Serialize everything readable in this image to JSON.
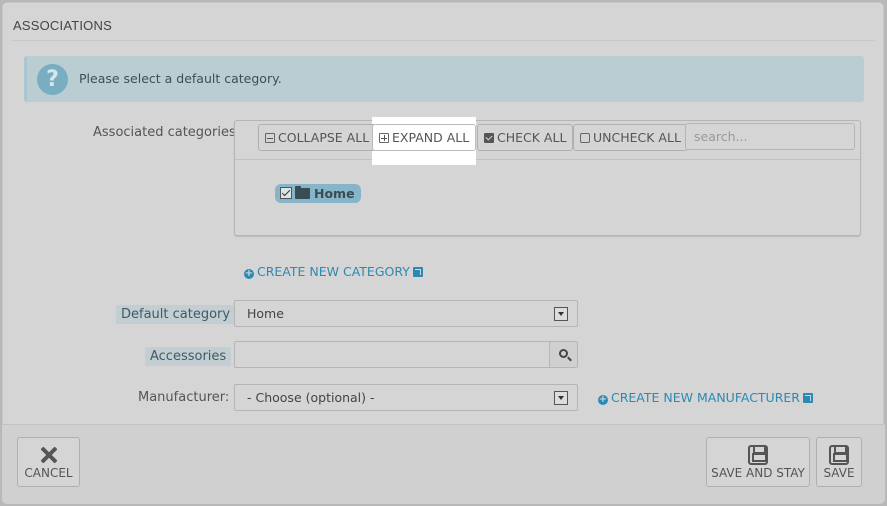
{
  "panel": {
    "heading": "ASSOCIATIONS"
  },
  "alert": {
    "icon": "question-icon",
    "icon_glyph": "?",
    "text": "Please select a default category."
  },
  "categories": {
    "label": "Associated categories",
    "toolbar": {
      "collapse_all": "COLLAPSE ALL",
      "expand_all": "EXPAND ALL",
      "check_all": "CHECK ALL",
      "uncheck_all": "UNCHECK ALL",
      "search_placeholder": "search..."
    },
    "tree": [
      {
        "label": "Home",
        "checked": true,
        "icon": "folder-open-icon"
      }
    ],
    "create_link": "CREATE NEW CATEGORY"
  },
  "default_category": {
    "label": "Default category",
    "value": "Home"
  },
  "accessories": {
    "label": "Accessories",
    "value": ""
  },
  "manufacturer": {
    "label": "Manufacturer:",
    "value": "- Choose (optional) -",
    "create_link": "CREATE NEW MANUFACTURER"
  },
  "footer": {
    "cancel": "CANCEL",
    "save_and_stay": "SAVE AND STAY",
    "save": "SAVE"
  },
  "colors": {
    "link": "#2b8ab3",
    "alert_bg": "#b9cdd3",
    "highlight": "#ffffff"
  }
}
